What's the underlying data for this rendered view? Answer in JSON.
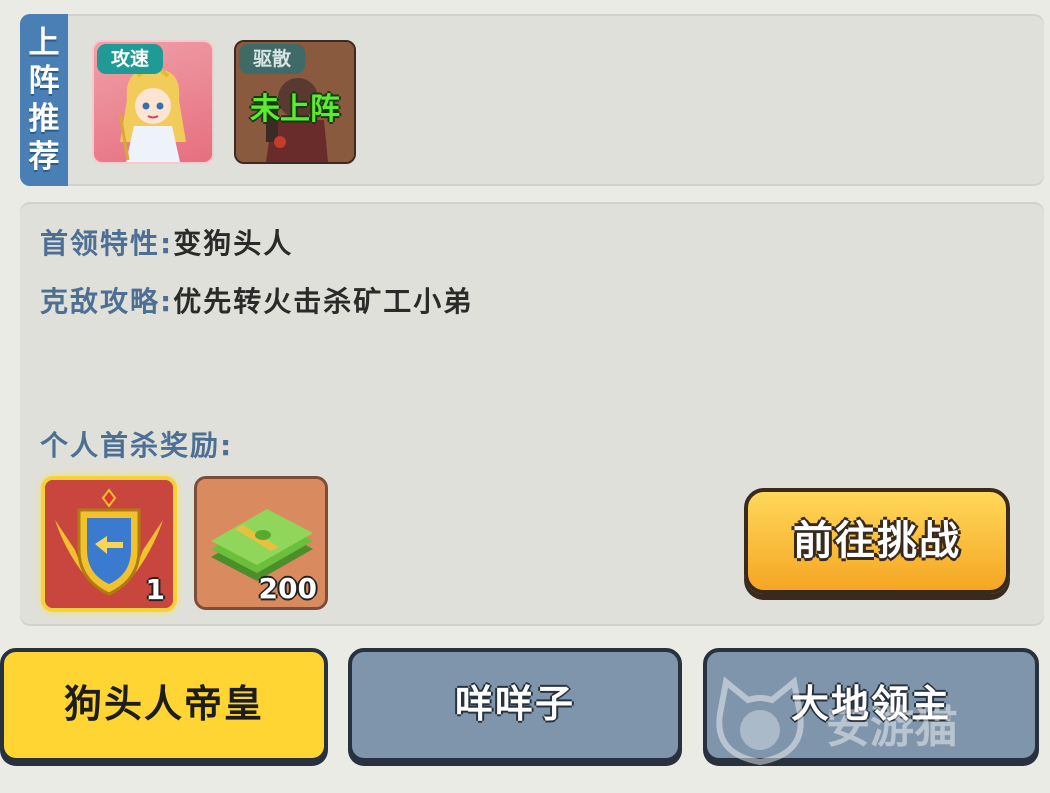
{
  "recommend": {
    "tab_chars": [
      "上",
      "阵",
      "推",
      "荐"
    ],
    "heroes": [
      {
        "tag": "攻速",
        "status": ""
      },
      {
        "tag": "驱散",
        "status": "未上阵"
      }
    ]
  },
  "boss_info": {
    "trait_label": "首领特性:",
    "trait_value": "变狗头人",
    "strategy_label": "克敌攻略:",
    "strategy_value": "优先转火击杀矿工小弟"
  },
  "rewards": {
    "title": "个人首杀奖励:",
    "items": [
      {
        "icon": "shield-badge-icon",
        "count": "1"
      },
      {
        "icon": "cash-stack-icon",
        "count": "200"
      }
    ]
  },
  "challenge_button": "前往挑战",
  "bottom_tabs": [
    {
      "label": "狗头人帝皇",
      "selected": true
    },
    {
      "label": "咩咩子",
      "selected": false
    },
    {
      "label": "大地领主",
      "selected": false
    }
  ],
  "watermark": "安游猫",
  "colors": {
    "tab_blue": "#4a7fb5",
    "selected_tab": "#ffd534",
    "unselected_tab": "#7f95ab",
    "button_orange": "#f5a623",
    "label_blue": "#4d6f93"
  }
}
